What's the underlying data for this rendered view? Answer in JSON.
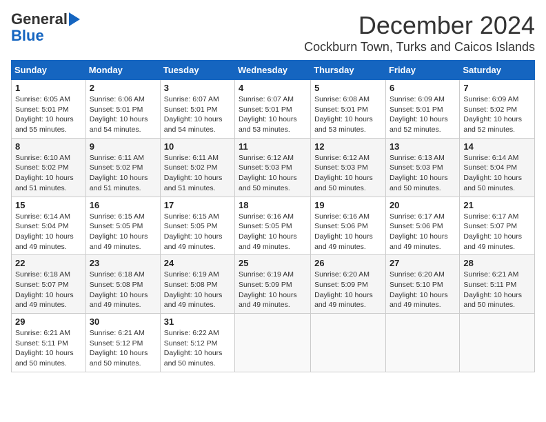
{
  "logo": {
    "line1": "General",
    "line2": "Blue"
  },
  "title": "December 2024",
  "location": "Cockburn Town, Turks and Caicos Islands",
  "headers": [
    "Sunday",
    "Monday",
    "Tuesday",
    "Wednesday",
    "Thursday",
    "Friday",
    "Saturday"
  ],
  "weeks": [
    [
      {
        "day": "1",
        "info": "Sunrise: 6:05 AM\nSunset: 5:01 PM\nDaylight: 10 hours\nand 55 minutes."
      },
      {
        "day": "2",
        "info": "Sunrise: 6:06 AM\nSunset: 5:01 PM\nDaylight: 10 hours\nand 54 minutes."
      },
      {
        "day": "3",
        "info": "Sunrise: 6:07 AM\nSunset: 5:01 PM\nDaylight: 10 hours\nand 54 minutes."
      },
      {
        "day": "4",
        "info": "Sunrise: 6:07 AM\nSunset: 5:01 PM\nDaylight: 10 hours\nand 53 minutes."
      },
      {
        "day": "5",
        "info": "Sunrise: 6:08 AM\nSunset: 5:01 PM\nDaylight: 10 hours\nand 53 minutes."
      },
      {
        "day": "6",
        "info": "Sunrise: 6:09 AM\nSunset: 5:01 PM\nDaylight: 10 hours\nand 52 minutes."
      },
      {
        "day": "7",
        "info": "Sunrise: 6:09 AM\nSunset: 5:02 PM\nDaylight: 10 hours\nand 52 minutes."
      }
    ],
    [
      {
        "day": "8",
        "info": "Sunrise: 6:10 AM\nSunset: 5:02 PM\nDaylight: 10 hours\nand 51 minutes."
      },
      {
        "day": "9",
        "info": "Sunrise: 6:11 AM\nSunset: 5:02 PM\nDaylight: 10 hours\nand 51 minutes."
      },
      {
        "day": "10",
        "info": "Sunrise: 6:11 AM\nSunset: 5:02 PM\nDaylight: 10 hours\nand 51 minutes."
      },
      {
        "day": "11",
        "info": "Sunrise: 6:12 AM\nSunset: 5:03 PM\nDaylight: 10 hours\nand 50 minutes."
      },
      {
        "day": "12",
        "info": "Sunrise: 6:12 AM\nSunset: 5:03 PM\nDaylight: 10 hours\nand 50 minutes."
      },
      {
        "day": "13",
        "info": "Sunrise: 6:13 AM\nSunset: 5:03 PM\nDaylight: 10 hours\nand 50 minutes."
      },
      {
        "day": "14",
        "info": "Sunrise: 6:14 AM\nSunset: 5:04 PM\nDaylight: 10 hours\nand 50 minutes."
      }
    ],
    [
      {
        "day": "15",
        "info": "Sunrise: 6:14 AM\nSunset: 5:04 PM\nDaylight: 10 hours\nand 49 minutes."
      },
      {
        "day": "16",
        "info": "Sunrise: 6:15 AM\nSunset: 5:05 PM\nDaylight: 10 hours\nand 49 minutes."
      },
      {
        "day": "17",
        "info": "Sunrise: 6:15 AM\nSunset: 5:05 PM\nDaylight: 10 hours\nand 49 minutes."
      },
      {
        "day": "18",
        "info": "Sunrise: 6:16 AM\nSunset: 5:05 PM\nDaylight: 10 hours\nand 49 minutes."
      },
      {
        "day": "19",
        "info": "Sunrise: 6:16 AM\nSunset: 5:06 PM\nDaylight: 10 hours\nand 49 minutes."
      },
      {
        "day": "20",
        "info": "Sunrise: 6:17 AM\nSunset: 5:06 PM\nDaylight: 10 hours\nand 49 minutes."
      },
      {
        "day": "21",
        "info": "Sunrise: 6:17 AM\nSunset: 5:07 PM\nDaylight: 10 hours\nand 49 minutes."
      }
    ],
    [
      {
        "day": "22",
        "info": "Sunrise: 6:18 AM\nSunset: 5:07 PM\nDaylight: 10 hours\nand 49 minutes."
      },
      {
        "day": "23",
        "info": "Sunrise: 6:18 AM\nSunset: 5:08 PM\nDaylight: 10 hours\nand 49 minutes."
      },
      {
        "day": "24",
        "info": "Sunrise: 6:19 AM\nSunset: 5:08 PM\nDaylight: 10 hours\nand 49 minutes."
      },
      {
        "day": "25",
        "info": "Sunrise: 6:19 AM\nSunset: 5:09 PM\nDaylight: 10 hours\nand 49 minutes."
      },
      {
        "day": "26",
        "info": "Sunrise: 6:20 AM\nSunset: 5:09 PM\nDaylight: 10 hours\nand 49 minutes."
      },
      {
        "day": "27",
        "info": "Sunrise: 6:20 AM\nSunset: 5:10 PM\nDaylight: 10 hours\nand 49 minutes."
      },
      {
        "day": "28",
        "info": "Sunrise: 6:21 AM\nSunset: 5:11 PM\nDaylight: 10 hours\nand 50 minutes."
      }
    ],
    [
      {
        "day": "29",
        "info": "Sunrise: 6:21 AM\nSunset: 5:11 PM\nDaylight: 10 hours\nand 50 minutes."
      },
      {
        "day": "30",
        "info": "Sunrise: 6:21 AM\nSunset: 5:12 PM\nDaylight: 10 hours\nand 50 minutes."
      },
      {
        "day": "31",
        "info": "Sunrise: 6:22 AM\nSunset: 5:12 PM\nDaylight: 10 hours\nand 50 minutes."
      },
      null,
      null,
      null,
      null
    ]
  ]
}
